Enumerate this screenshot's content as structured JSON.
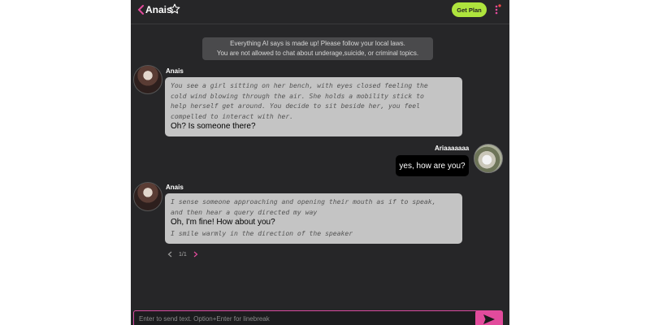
{
  "header": {
    "title": "Anais",
    "plan_button": "Get Plan",
    "accent": "#e24b9c",
    "plan_color": "#aee43d"
  },
  "notice": {
    "line1": "Everything AI says is made up! Please follow your local laws.",
    "line2": "You are not allowed to chat about underage,suicide, or criminal topics."
  },
  "messages": [
    {
      "sender": "Anais",
      "action_lines": [
        "You see a girl sitting on her bench, with eyes closed feeling the",
        "cold wind blowing through the air. She holds a mobility stick to",
        "help herself get around. You decide to sit beside her, you feel",
        "compelled to interact with her."
      ],
      "speech": "Oh? Is someone there?"
    },
    {
      "sender": "Ariaaaaaaa",
      "text": "yes, how are you?"
    },
    {
      "sender": "Anais",
      "action_lines": [
        "I sense someone approaching and opening their mouth as if to speak,",
        "and then hear a query directed my way"
      ],
      "speech": "Oh, I'm fine! How about you?",
      "action_after": "I smile warmly in the direction of the speaker"
    }
  ],
  "pager": {
    "label": "1/1"
  },
  "composer": {
    "placeholder": "Enter to send text. Option+Enter for linebreak"
  }
}
